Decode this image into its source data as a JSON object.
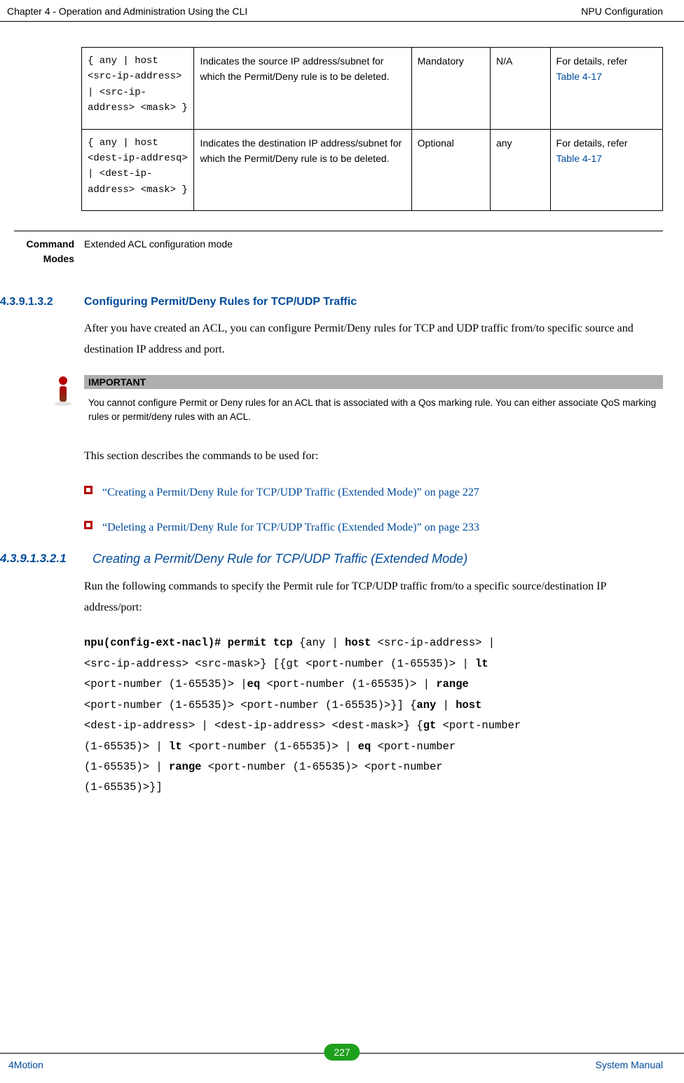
{
  "header": {
    "left": "Chapter 4 - Operation and Administration Using the CLI",
    "right": "NPU Configuration"
  },
  "table": {
    "rows": [
      {
        "param": "{ any | host <src-ip-address> | <src-ip-address> <mask> }",
        "desc": "Indicates the source IP address/subnet for which the Permit/Deny rule is to be deleted.",
        "presence": "Mandatory",
        "default": "N/A",
        "details_pre": "For details, refer ",
        "details_link": "Table 4-17"
      },
      {
        "param": "{ any | host <dest-ip-addresq> | <dest-ip-address> <mask> }",
        "desc": "Indicates the destination IP address/subnet for which the Permit/Deny rule is to be deleted.",
        "presence": "Optional",
        "default": "any",
        "details_pre": "For details, refer ",
        "details_link": "Table 4-17"
      }
    ]
  },
  "modes": {
    "label": "Command Modes",
    "value": "Extended ACL configuration mode"
  },
  "section1": {
    "num": "4.3.9.1.3.2",
    "title": "Configuring Permit/Deny Rules for TCP/UDP Traffic",
    "para": "After you have created an ACL, you can configure Permit/Deny rules for TCP and UDP traffic from/to specific source and destination IP address and port."
  },
  "important": {
    "heading": "IMPORTANT",
    "text": "You cannot configure Permit or Deny rules for an ACL that is associated with a Qos marking rule. You can either associate QoS marking rules or permit/deny rules with an ACL."
  },
  "intro2": "This section describes the commands to be used for:",
  "bullets": [
    "“Creating a Permit/Deny Rule for TCP/UDP Traffic (Extended Mode)” on page 227",
    "“Deleting a Permit/Deny Rule for TCP/UDP Traffic (Extended Mode)” on page 233"
  ],
  "section2": {
    "num": "4.3.9.1.3.2.1",
    "title": "Creating a Permit/Deny Rule for TCP/UDP Traffic (Extended Mode)",
    "para": "Run the following commands to specify the Permit rule for TCP/UDP traffic from/to a specific source/destination IP address/port:"
  },
  "cmd": {
    "l1a": "npu(config-ext-nacl)# permit tcp ",
    "l1b": "{any | ",
    "l1c": "host",
    "l1d": " <src-ip-address> | ",
    "l2a": "<src-ip-address> <src-mask>} [{gt <port-number (1-65535)> | ",
    "l2b": "lt",
    "l3a": "<port-number (1-65535)> |",
    "l3b": "eq",
    "l3c": " <port-number (1-65535)> | ",
    "l3d": "range",
    "l4": "<port-number (1-65535)> <port-number (1-65535)>}] {",
    "l4b": "any",
    "l4c": " | ",
    "l4d": "host",
    "l5a": "<dest-ip-address> | <dest-ip-address> <dest-mask>} {",
    "l5b": "gt",
    "l5c": " <port-number ",
    "l6a": "(1-65535)>   | ",
    "l6b": "lt",
    "l6c": " <port-number (1-65535)> | ",
    "l6d": "eq",
    "l6e": " <port-number ",
    "l7a": "(1-65535)> | ",
    "l7b": "range",
    "l7c": " <port-number (1-65535)> <port-number ",
    "l8": "(1-65535)>}]"
  },
  "footer": {
    "left": "4Motion",
    "page": "227",
    "right": "System Manual"
  }
}
